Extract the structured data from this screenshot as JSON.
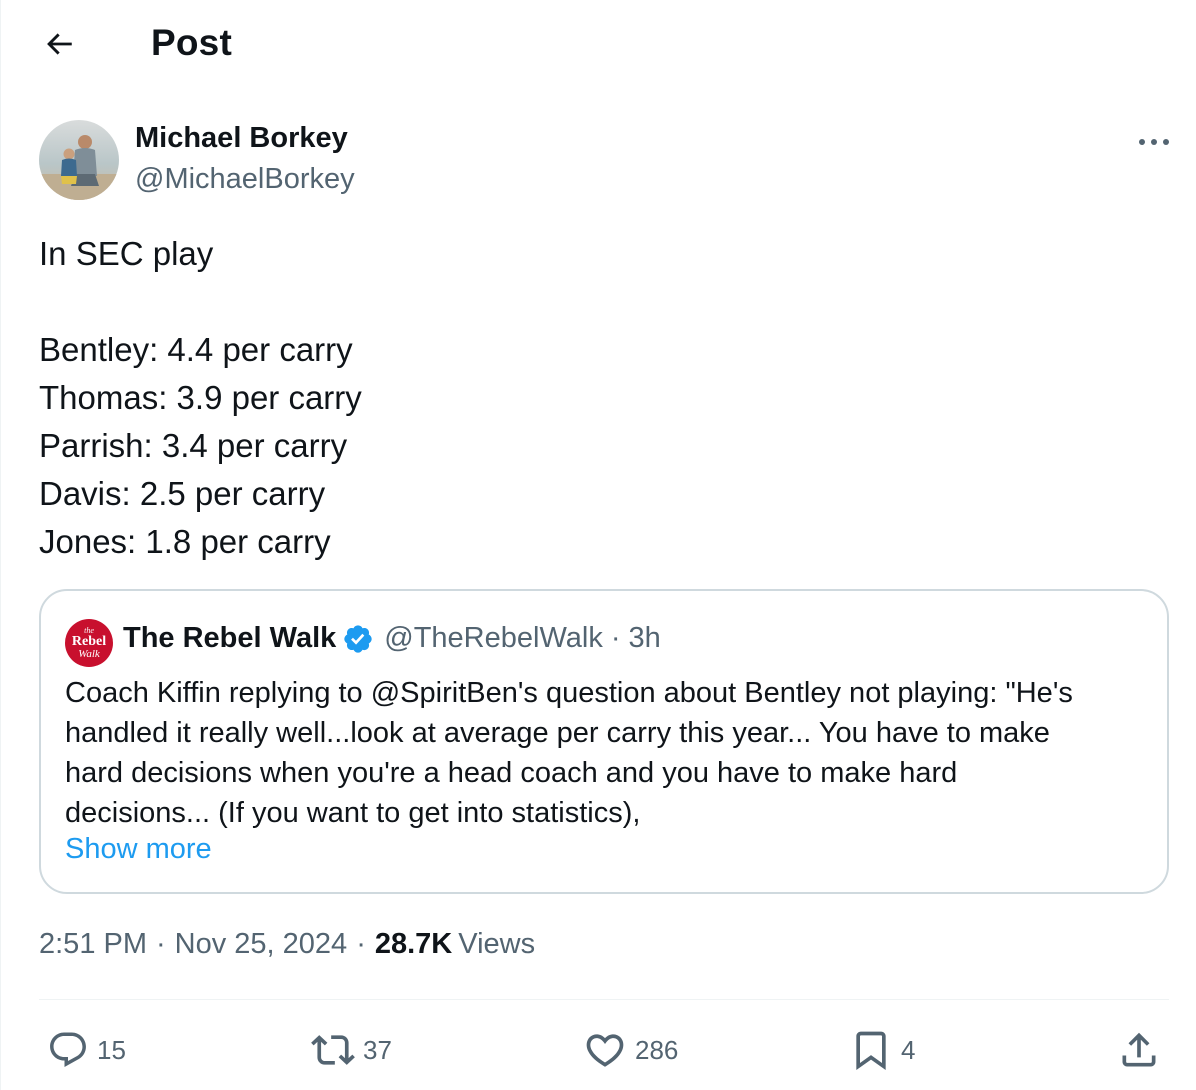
{
  "header": {
    "title": "Post"
  },
  "author": {
    "name": "Michael Borkey",
    "handle": "@MichaelBorkey"
  },
  "post": {
    "lines": [
      "In SEC play",
      "",
      "Bentley: 4.4 per carry",
      "Thomas: 3.9 per carry",
      "Parrish: 3.4 per carry",
      "Davis: 2.5 per carry",
      "Jones: 1.8 per carry"
    ]
  },
  "quote": {
    "name": "The Rebel Walk",
    "handle": "@TheRebelWalk",
    "separator": "·",
    "time": "3h",
    "avatar_text": {
      "small": "the",
      "big": "Rebel",
      "walk": "Walk"
    },
    "lines": [
      "Coach Kiffin replying to @SpiritBen's question about Bentley not playing: \"He's",
      "handled it really well...look at average per carry this year... You have to make",
      "hard decisions when you're a head coach and you have to make hard",
      "decisions... (If you want to get into statistics),"
    ],
    "show_more": "Show more"
  },
  "meta": {
    "time": "2:51 PM",
    "separator": "·",
    "date": "Nov 25, 2024",
    "views_count": "28.7K",
    "views_label": "Views"
  },
  "actions": {
    "replies": "15",
    "reposts": "37",
    "likes": "286",
    "bookmarks": "4"
  },
  "colors": {
    "text": "#0f1419",
    "secondary": "#536471",
    "link": "#1d9bf0",
    "border": "#cfd9de",
    "verified": "#1d9bf0",
    "brand_red": "#c8102e"
  }
}
